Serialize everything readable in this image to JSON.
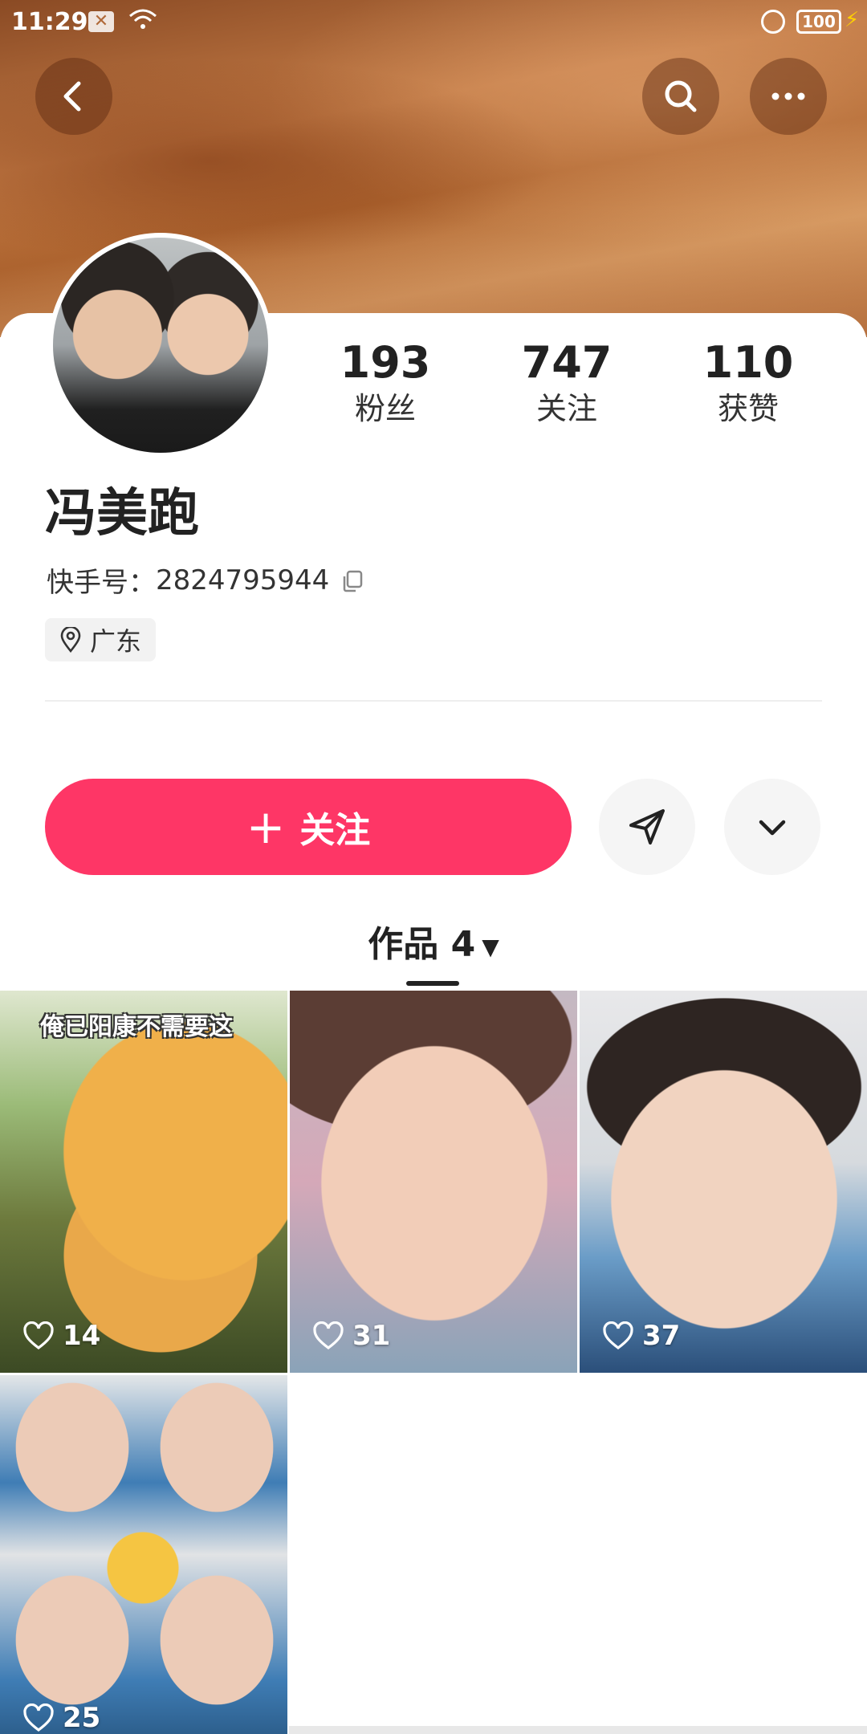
{
  "status_bar": {
    "time": "11:29",
    "battery": "100"
  },
  "profile": {
    "name": "冯美跑",
    "id_label": "快手号：",
    "id_value": "2824795944",
    "location": "广东"
  },
  "stats": [
    {
      "value": "193",
      "label": "粉丝"
    },
    {
      "value": "747",
      "label": "关注"
    },
    {
      "value": "110",
      "label": "获赞"
    }
  ],
  "actions": {
    "follow_label": "关注"
  },
  "works_tab": {
    "label": "作品 4"
  },
  "grid": [
    {
      "caption": "俺已阳康不需要这",
      "likes": "14"
    },
    {
      "likes": "31"
    },
    {
      "likes": "37"
    },
    {
      "likes": "25"
    }
  ],
  "colors": {
    "accent": "#fe3666",
    "card_bg": "#ffffff"
  },
  "icons": [
    "back-icon",
    "search-icon",
    "more-icon",
    "copy-icon",
    "location-pin-icon",
    "plus-icon",
    "share-icon",
    "chevron-down-icon",
    "heart-icon"
  ]
}
